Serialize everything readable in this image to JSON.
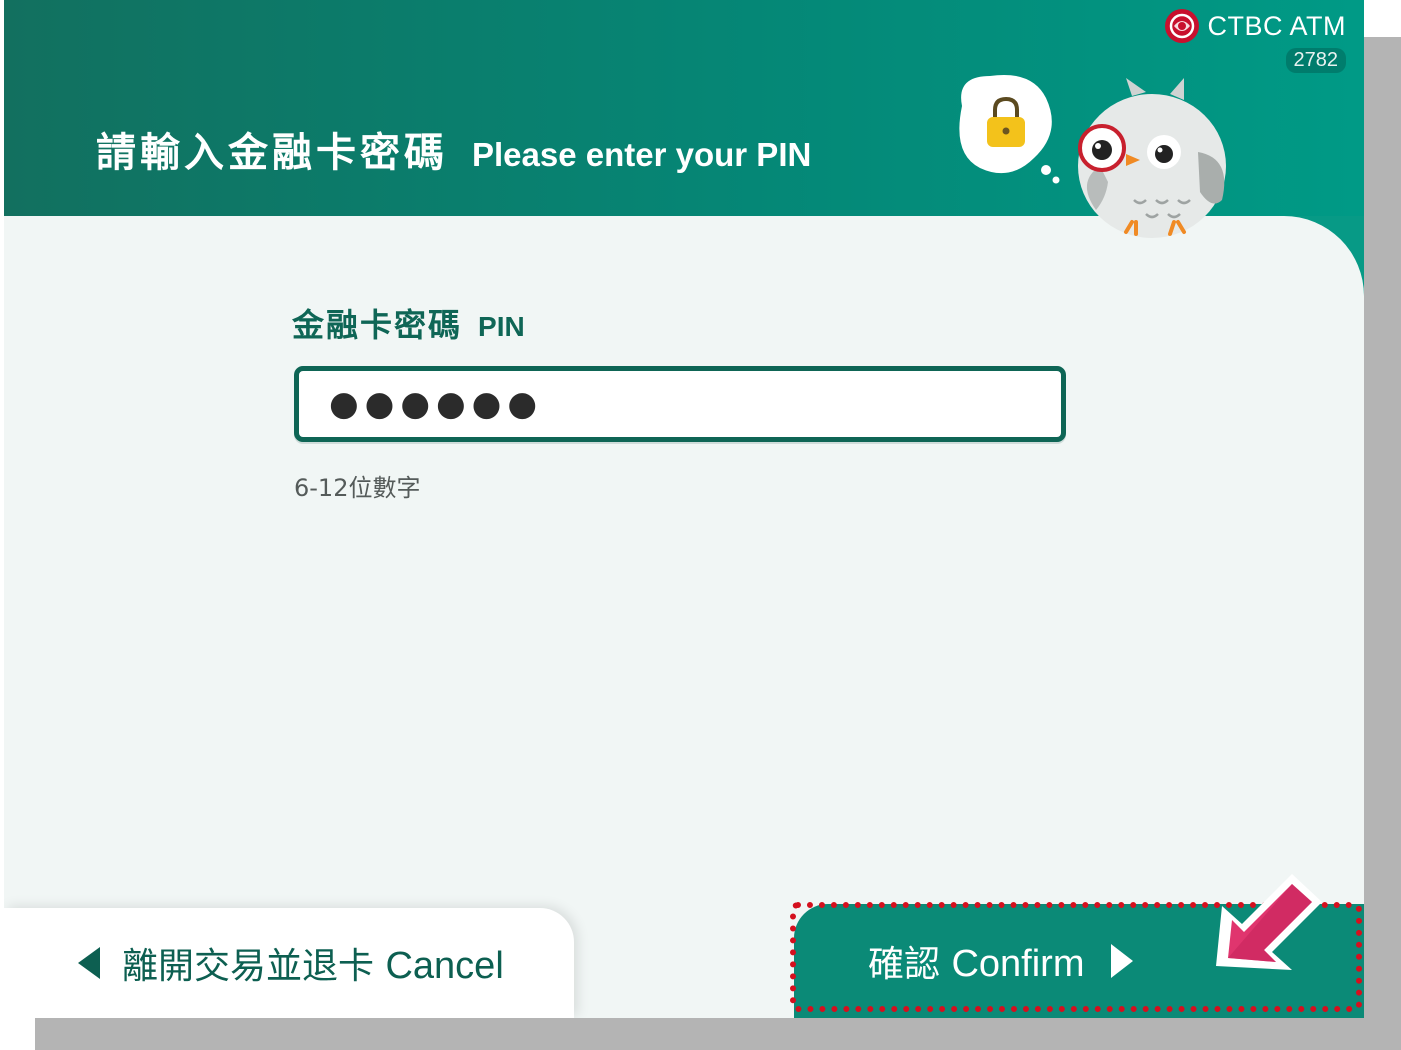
{
  "brand": {
    "name": "CTBC ATM",
    "atm_id": "2782"
  },
  "header": {
    "title_zh": "請輸入金融卡密碼",
    "title_en": "Please enter your PIN"
  },
  "form": {
    "label_zh": "金融卡密碼",
    "label_en": "PIN",
    "pin_masked": "●●●●●●",
    "hint": "6-12位數字"
  },
  "buttons": {
    "cancel_zh": "離開交易並退卡",
    "cancel_en": "Cancel",
    "confirm_zh": "確認",
    "confirm_en": "Confirm"
  },
  "icons": {
    "brand_logo": "ctbc-logo-icon",
    "lock": "lock-icon",
    "mascot": "owl-mascot",
    "cancel_arrow": "triangle-left-icon",
    "confirm_arrow": "triangle-right-icon",
    "pointer": "pointer-arrow-icon"
  },
  "colors": {
    "primary": "#0b8a77",
    "header_dark": "#12705f",
    "label": "#0f6656",
    "highlight": "#d4101e",
    "pointer": "#e0356e"
  }
}
